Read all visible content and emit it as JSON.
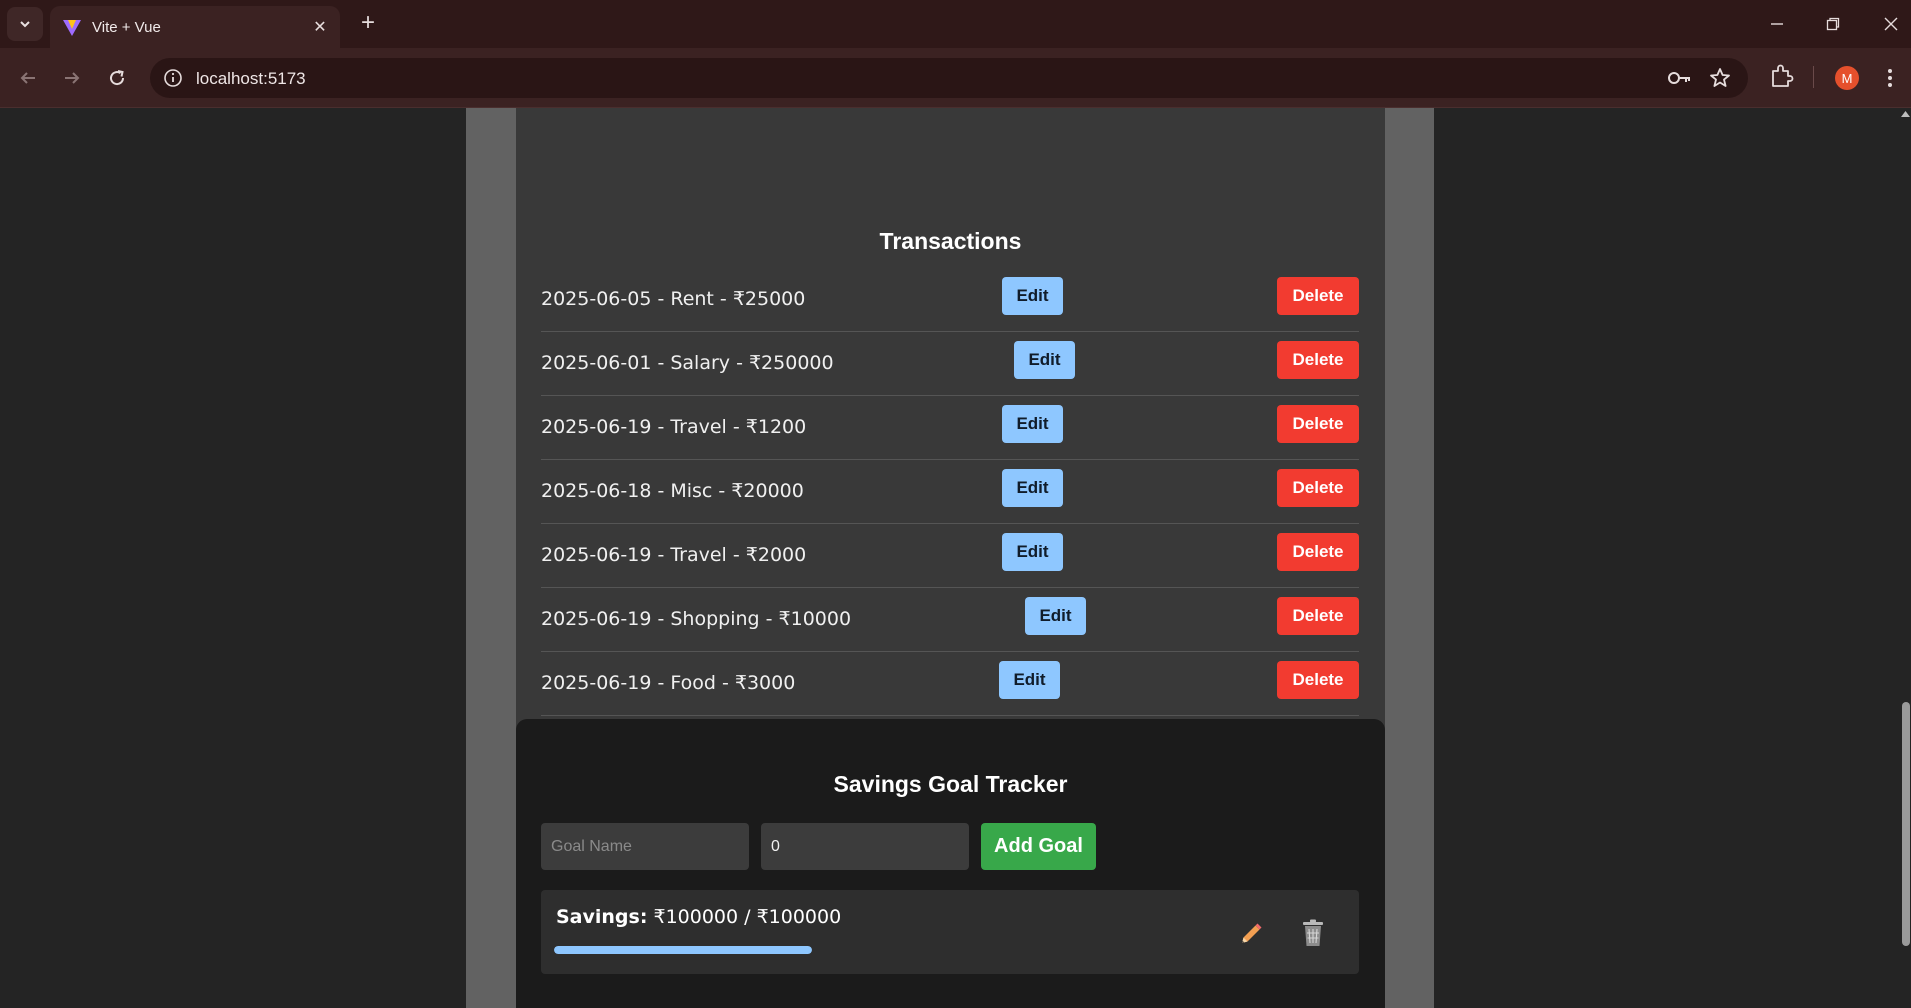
{
  "browser": {
    "tab_title": "Vite + Vue",
    "address": "localhost:5173",
    "profile_initial": "M"
  },
  "transactions": {
    "title": "Transactions",
    "edit_label": "Edit",
    "delete_label": "Delete",
    "items": [
      {
        "text": "2025-06-05 - Rent - ₹25000"
      },
      {
        "text": "2025-06-01 - Salary - ₹250000"
      },
      {
        "text": "2025-06-19 - Travel - ₹1200"
      },
      {
        "text": "2025-06-18 - Misc - ₹20000"
      },
      {
        "text": "2025-06-19 - Travel - ₹2000"
      },
      {
        "text": "2025-06-19 - Shopping - ₹10000"
      },
      {
        "text": "2025-06-19 - Food - ₹3000"
      }
    ]
  },
  "savings": {
    "title": "Savings Goal Tracker",
    "name_placeholder": "Goal Name",
    "amount_value": "0",
    "add_label": "Add Goal",
    "goals": [
      {
        "name": "Savings:",
        "amounts": "₹100000 / ₹100000",
        "progress": 1.0
      }
    ]
  },
  "colors": {
    "edit_button": "#8ec7ff",
    "delete_button": "#f23b30",
    "add_button": "#38a84a",
    "browser_frame": "#3b2222"
  }
}
